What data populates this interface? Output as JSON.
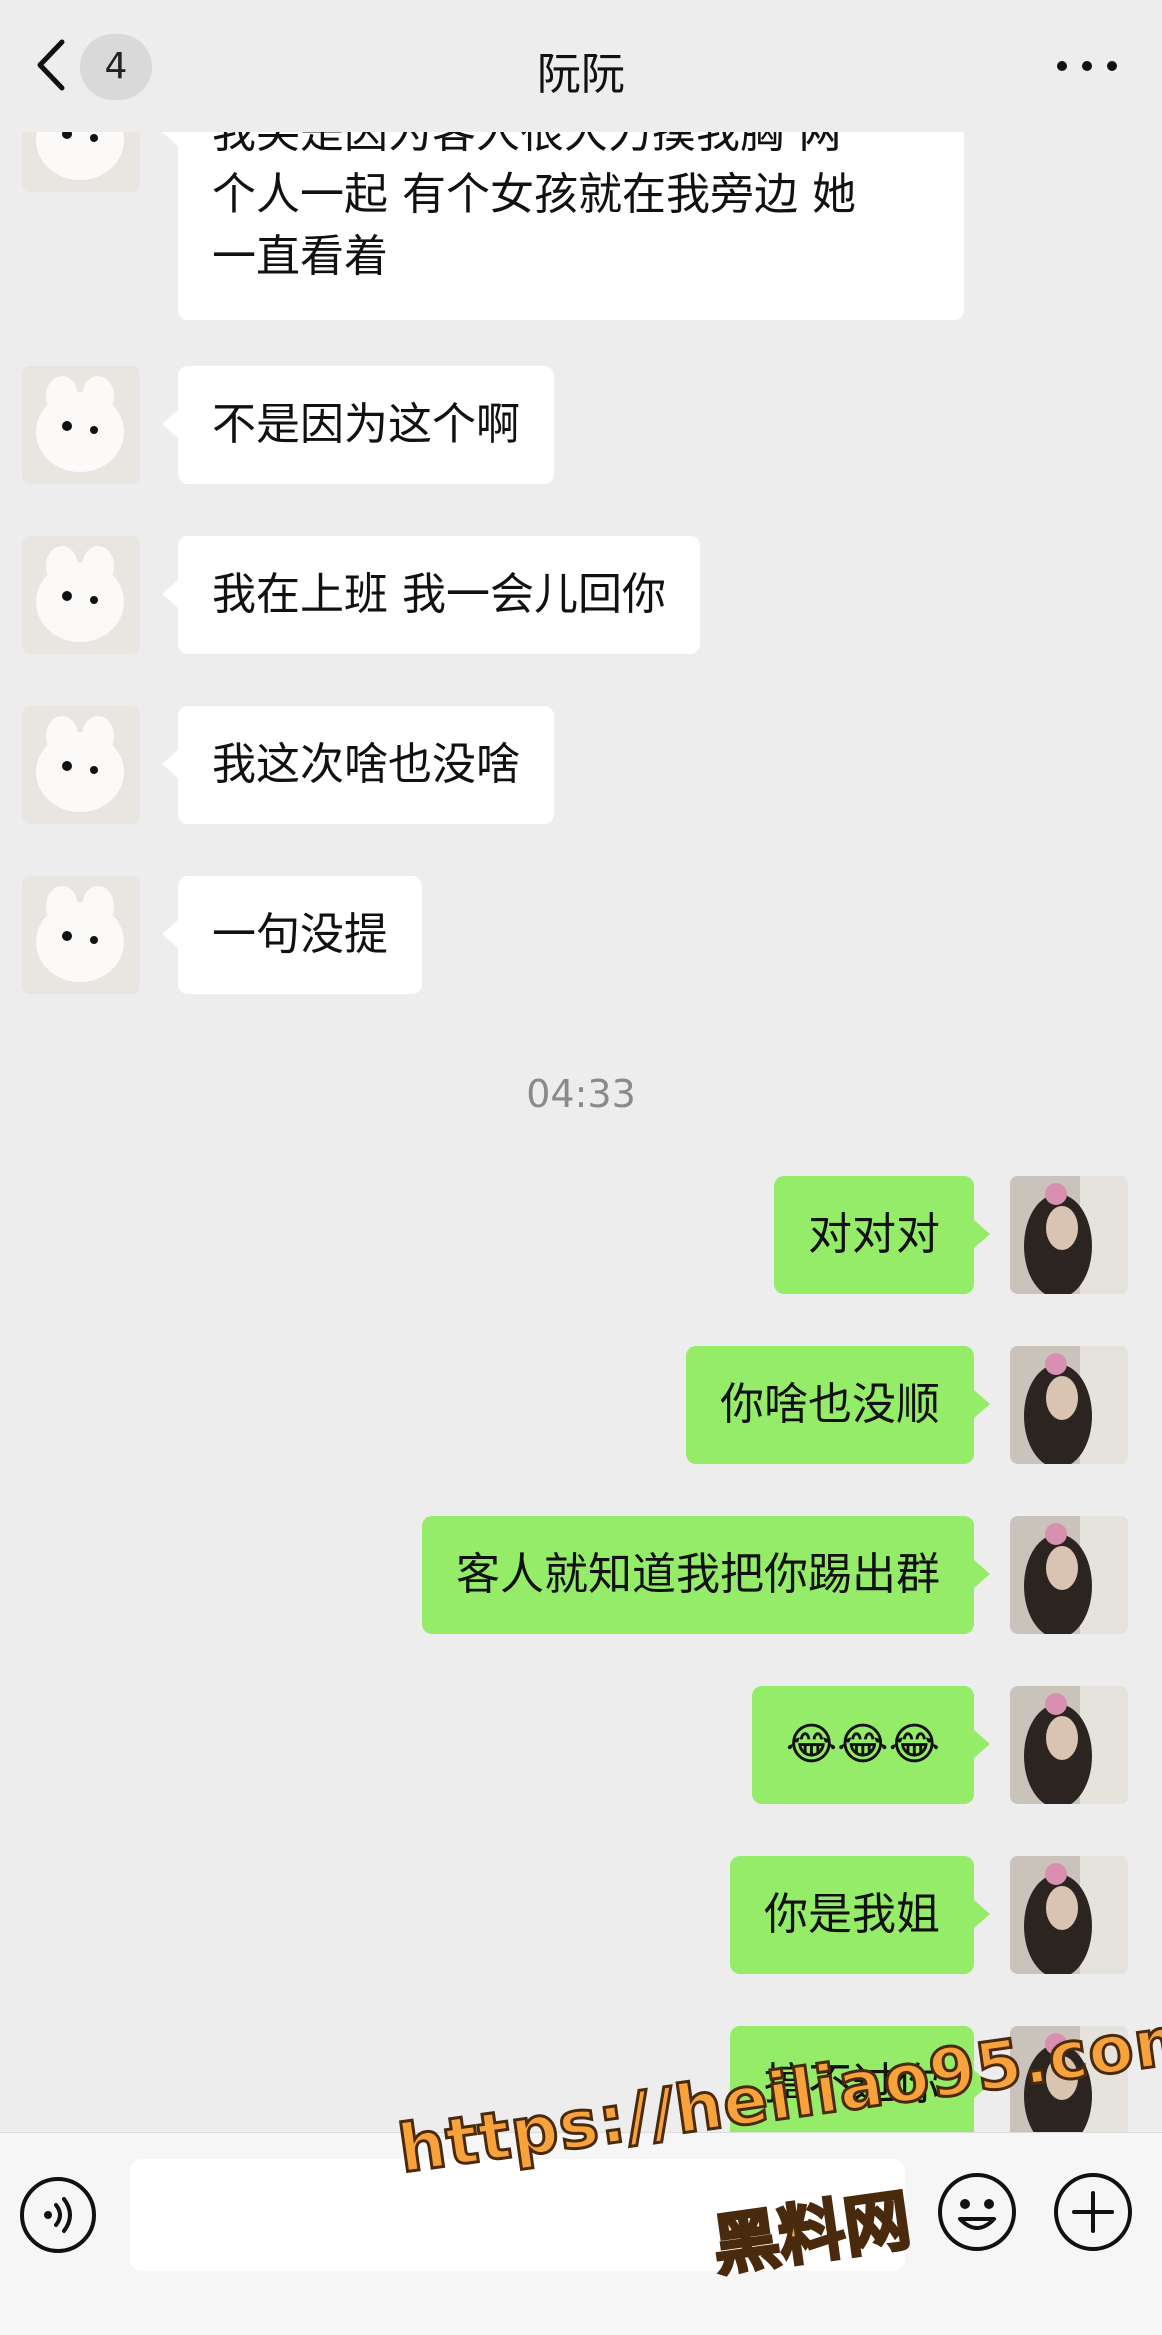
{
  "header": {
    "unread_count": "4",
    "title": "阮阮"
  },
  "messages": [
    {
      "side": "left",
      "text": "我笑是因为客人很大力摸我胸 两\n个人一起 有个女孩就在我旁边 她\n一直看着"
    },
    {
      "side": "left",
      "text": "不是因为这个啊"
    },
    {
      "side": "left",
      "text": "我在上班 我一会儿回你"
    },
    {
      "side": "left",
      "text": "我这次啥也没啥"
    },
    {
      "side": "left",
      "text": "一句没提"
    },
    {
      "side": "right",
      "text": "对对对"
    },
    {
      "side": "right",
      "text": "你啥也没顺"
    },
    {
      "side": "right",
      "text": "客人就知道我把你踢出群"
    },
    {
      "side": "right",
      "text": "😂😂😂"
    },
    {
      "side": "right",
      "text": "你是我姐"
    },
    {
      "side": "right",
      "text": "搞不过你"
    }
  ],
  "timestamp": "04:33",
  "input": {
    "value": ""
  },
  "watermark": {
    "line1": "https://heiliao95.com",
    "line2": "黑料网"
  },
  "colors": {
    "bg": "#ededed",
    "bubble_out": "#95ec69",
    "bubble_in": "#ffffff",
    "watermark": "#f7a23b"
  },
  "icons": [
    "back-arrow-icon",
    "more-icon",
    "voice-icon",
    "emoji-icon",
    "plus-icon"
  ]
}
